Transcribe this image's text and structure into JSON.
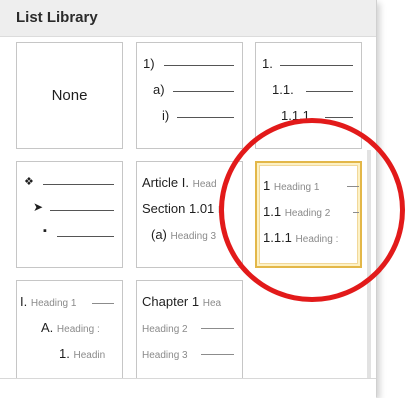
{
  "header": {
    "title": "List Library"
  },
  "tiles": {
    "none": {
      "label": "None"
    },
    "numbered": {
      "l1": "1)",
      "l2": "a)",
      "l3": "i)"
    },
    "outline_numbered": {
      "l1": "1.",
      "l2": "1.1.",
      "l3": "1.1.1."
    },
    "bullets": {
      "l1": "❖",
      "l2": "➤",
      "l3": "▪"
    },
    "article": {
      "l1": "Article I.",
      "l1h": "Head",
      "l2": "Section 1.01",
      "l2h": "I",
      "l3": "(a)",
      "l3h": "Heading 3"
    },
    "heading_numbered": {
      "l1": "1",
      "l1h": "Heading 1",
      "l2": "1.1",
      "l2h": "Heading 2",
      "l3": "1.1.1",
      "l3h": "Heading :"
    },
    "roman": {
      "l1": "I.",
      "l1h": "Heading 1",
      "l2": "A.",
      "l2h": "Heading :",
      "l3": "1.",
      "l3h": "Headin"
    },
    "chapter": {
      "l1": "Chapter 1",
      "l1h": "Hea",
      "l2h": "Heading 2",
      "l3h": "Heading 3"
    }
  },
  "colors": {
    "selected_tile_border": "#e3b748",
    "annotation_ring": "#e21a1a"
  }
}
